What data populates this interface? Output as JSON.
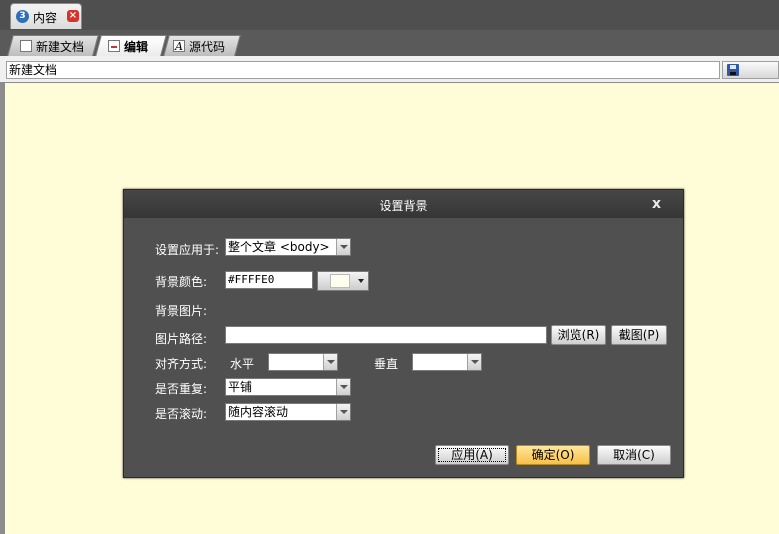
{
  "window_tab": {
    "number": "3",
    "label": "内容"
  },
  "editor_tabs": [
    {
      "label": "新建文档",
      "icon": "document-icon"
    },
    {
      "label": "编辑",
      "icon": "edit-icon"
    },
    {
      "label": "源代码",
      "icon": "source-code-icon"
    }
  ],
  "filename": {
    "value": "新建文档"
  },
  "dialog": {
    "title": "设置背景",
    "close": "x",
    "apply_to": {
      "label": "设置应用于:",
      "value": "整个文章 <body>"
    },
    "bg_color": {
      "label": "背景颜色:",
      "value": "#FFFFE0",
      "swatch_color": "#fffff0"
    },
    "bg_image_label": "背景图片:",
    "image_path": {
      "label": "图片路径:",
      "value": ""
    },
    "browse_button": "浏览(R)",
    "screenshot_button": "截图(P)",
    "align": {
      "label": "对齐方式:",
      "horizontal_label": "水平",
      "horizontal_value": "",
      "vertical_label": "垂直",
      "vertical_value": ""
    },
    "repeat": {
      "label": "是否重复:",
      "value": "平铺"
    },
    "scroll": {
      "label": "是否滚动:",
      "value": "随内容滚动"
    },
    "apply_button": "应用(A)",
    "ok_button": "确定(O)",
    "cancel_button": "取消(C)"
  },
  "colors": {
    "editor_bg": "#fefdd8",
    "dialog_bg": "#505050",
    "primary_button": "#f7c14a"
  }
}
